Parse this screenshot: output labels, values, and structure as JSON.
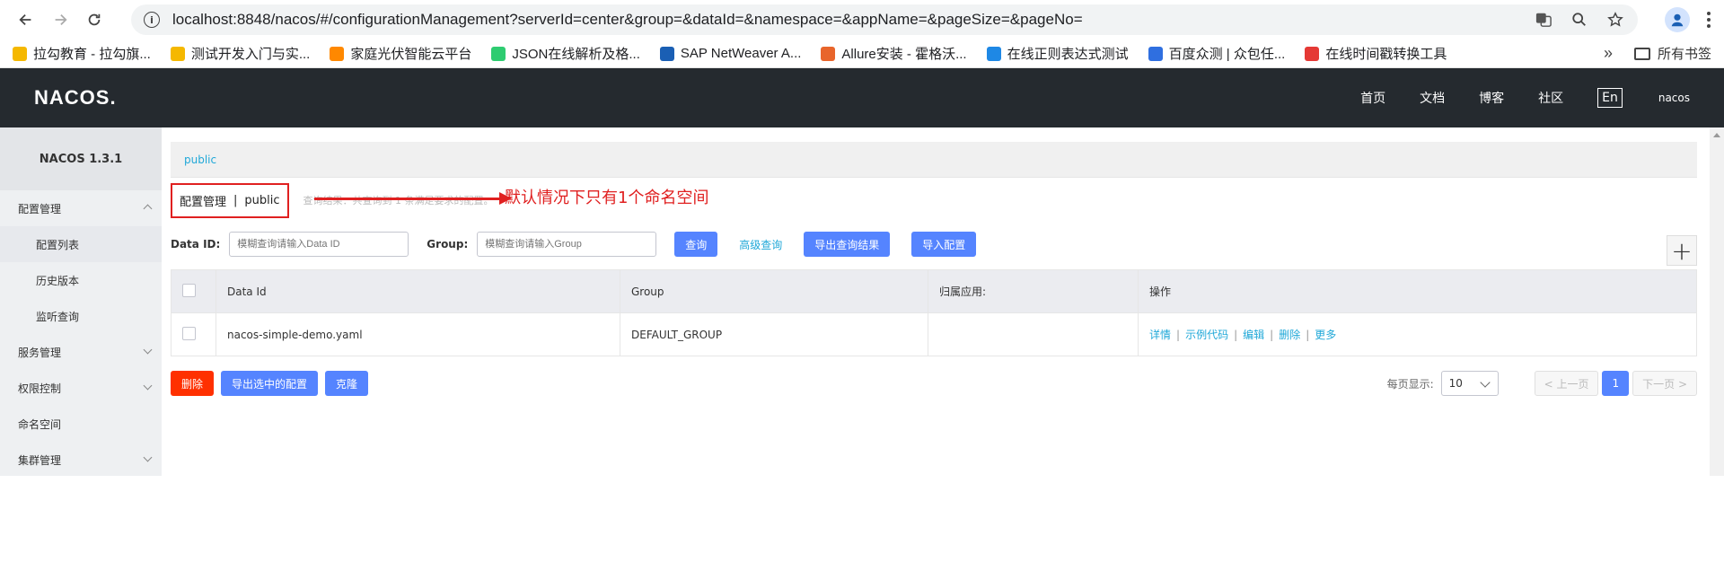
{
  "browser": {
    "url": "localhost:8848/nacos/#/configurationManagement?serverId=center&group=&dataId=&namespace=&appName=&pageSize=&pageNo=",
    "bookmarks": [
      {
        "label": "拉勾教育 - 拉勾旗...",
        "color": "#f5b800",
        "icon": "lagou-icon"
      },
      {
        "label": "测试开发入门与实...",
        "color": "#f5b800",
        "icon": "lagou-icon"
      },
      {
        "label": "家庭光伏智能云平台",
        "color": "#ff8800",
        "icon": "solar-icon"
      },
      {
        "label": "JSON在线解析及格...",
        "color": "#2ecc71",
        "icon": "json-icon"
      },
      {
        "label": "SAP NetWeaver A...",
        "color": "#1a5fb4",
        "icon": "sap-icon"
      },
      {
        "label": "Allure安装 - 霍格沃...",
        "color": "#e8652b",
        "icon": "allure-icon"
      },
      {
        "label": "在线正则表达式测试",
        "color": "#1e88e5",
        "icon": "regex-icon"
      },
      {
        "label": "百度众测 | 众包任...",
        "color": "#2f6fe0",
        "icon": "baidu-icon"
      },
      {
        "label": "在线时间戳转换工具",
        "color": "#e53935",
        "icon": "clock-icon"
      }
    ],
    "more": "»",
    "all_bookmarks": "所有书签"
  },
  "header": {
    "logo": "NACOS.",
    "nav": [
      "首页",
      "文档",
      "博客",
      "社区"
    ],
    "lang": "En",
    "user": "nacos"
  },
  "sidebar": {
    "version": "NACOS 1.3.1",
    "items": [
      {
        "label": "配置管理"
      },
      {
        "label": "配置列表"
      },
      {
        "label": "历史版本"
      },
      {
        "label": "监听查询"
      },
      {
        "label": "服务管理"
      },
      {
        "label": "权限控制"
      },
      {
        "label": "命名空间"
      },
      {
        "label": "集群管理"
      }
    ]
  },
  "main": {
    "namespace_tab": "public",
    "title": "配置管理",
    "title_sep": "|",
    "title_ns": "public",
    "faded_hint": "查询结果：共查询到 1 条满足要求的配置。",
    "annotation": "默认情况下只有1个命名空间",
    "search": {
      "dataid_label": "Data ID:",
      "dataid_placeholder": "模糊查询请输入Data ID",
      "group_label": "Group:",
      "group_placeholder": "模糊查询请输入Group",
      "query_btn": "查询",
      "advanced": "高级查询",
      "export_btn": "导出查询结果",
      "import_btn": "导入配置",
      "add_icon": "+"
    },
    "table": {
      "headers": [
        "Data Id",
        "Group",
        "归属应用:",
        "操作"
      ],
      "rows": [
        {
          "dataId": "nacos-simple-demo.yaml",
          "group": "DEFAULT_GROUP",
          "app": "",
          "ops": [
            "详情",
            "示例代码",
            "编辑",
            "删除",
            "更多"
          ]
        }
      ]
    },
    "bottom": {
      "delete_btn": "删除",
      "export_selected_btn": "导出选中的配置",
      "clone_btn": "克隆",
      "page_size_label": "每页显示:",
      "page_size": "10",
      "prev": "< 上一页",
      "current": "1",
      "next": "下一页 >"
    }
  }
}
